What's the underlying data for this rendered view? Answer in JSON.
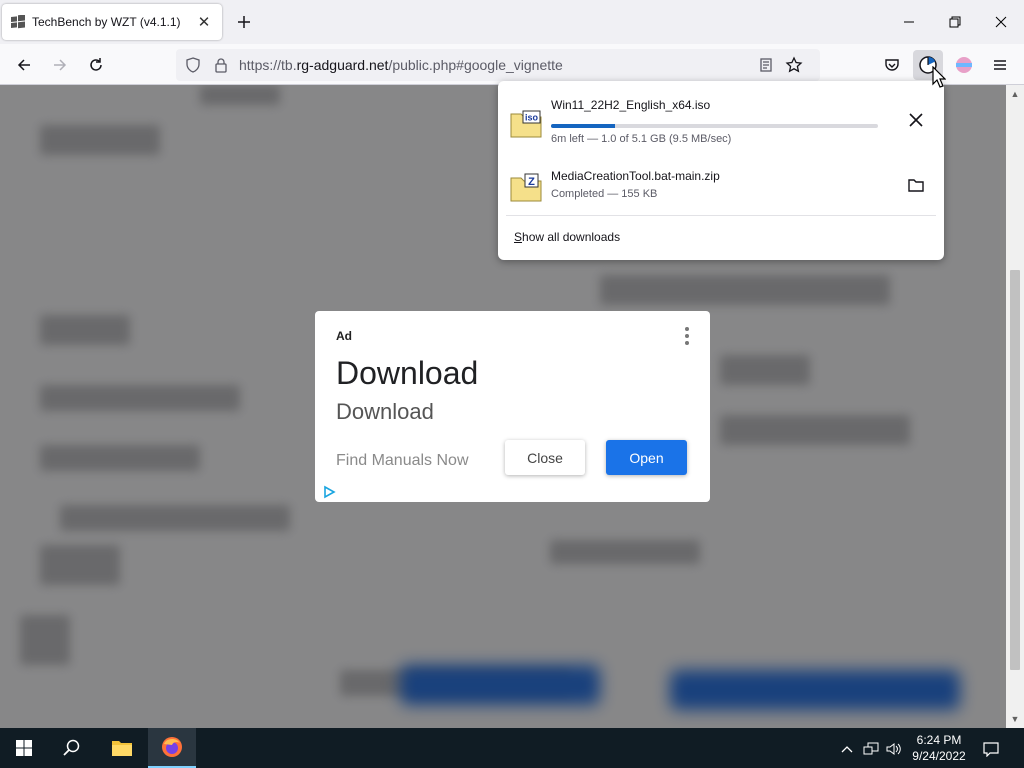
{
  "browser": {
    "tab": {
      "title": "TechBench by WZT (v4.1.1)",
      "favicon": "windows-logo-icon"
    },
    "url": {
      "prefix": "https://tb.",
      "host": "rg-adguard.net",
      "path": "/public.php#google_vignette"
    },
    "toolbar_icons": [
      "back-icon",
      "forward-icon",
      "reload-icon",
      "shield-icon",
      "lock-icon",
      "reader-view-icon",
      "bookmark-star-icon",
      "pocket-icon",
      "downloads-icon",
      "account-icon",
      "menu-icon"
    ]
  },
  "downloads": {
    "items": [
      {
        "name": "Win11_22H2_English_x64.iso",
        "status": "6m left — 1.0 of 5.1 GB (9.5 MB/sec)",
        "progress": 0.196,
        "icon_label": "iso",
        "action": "cancel-icon"
      },
      {
        "name": "MediaCreationTool.bat-main.zip",
        "status": "Completed — 155 KB",
        "icon_label": "Z",
        "action": "folder-icon"
      }
    ],
    "show_all": {
      "accel": "S",
      "rest": "how all downloads"
    }
  },
  "ad": {
    "label": "Ad",
    "headline": "Download",
    "subheadline": "Download",
    "description": "Find Manuals Now",
    "close_label": "Close",
    "open_label": "Open",
    "accent_color": "#1a73e8"
  },
  "taskbar": {
    "time": "6:24 PM",
    "date": "9/24/2022",
    "active_app": "firefox"
  }
}
